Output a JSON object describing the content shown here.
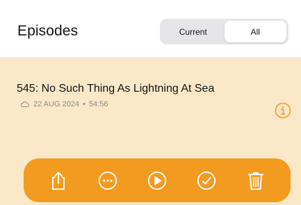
{
  "header": {
    "title": "Episodes"
  },
  "filter": {
    "options": [
      "Current",
      "All"
    ],
    "selected": "All"
  },
  "episode": {
    "title": "545: No Such Thing As Lightning At Sea",
    "date": "22 AUG 2024",
    "separator": "•",
    "duration": "54:56"
  },
  "icons": {
    "meta": "cloud-icon",
    "info": "info-icon",
    "actions": [
      "share-icon",
      "more-icon",
      "play-icon",
      "mark-played-icon",
      "trash-icon"
    ]
  },
  "colors": {
    "accent": "#f39b1f",
    "row_background": "#fbe8c8",
    "segment_track": "#e6e6e9",
    "meta_text": "#8d8a86"
  }
}
